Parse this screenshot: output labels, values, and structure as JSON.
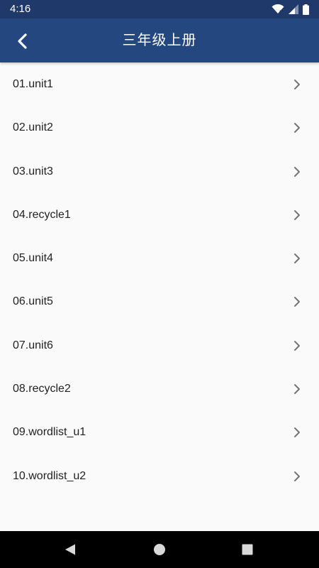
{
  "status_bar": {
    "time": "4:16",
    "icons": [
      "wifi-icon",
      "cell-signal-icon",
      "battery-icon"
    ]
  },
  "app_bar": {
    "title": "三年级上册",
    "back_icon": "back-arrow-icon",
    "background": "#24477f"
  },
  "list": {
    "items": [
      {
        "label": "01.unit1"
      },
      {
        "label": "02.unit2"
      },
      {
        "label": "03.unit3"
      },
      {
        "label": "04.recycle1"
      },
      {
        "label": "05.unit4"
      },
      {
        "label": "06.unit5"
      },
      {
        "label": "07.unit6"
      },
      {
        "label": "08.recycle2"
      },
      {
        "label": "09.wordlist_u1"
      },
      {
        "label": "10.wordlist_u2"
      }
    ],
    "item_icon": "chevron-right-icon"
  },
  "nav_bar": {
    "buttons": [
      "back-triangle-icon",
      "home-circle-icon",
      "recents-square-icon"
    ]
  }
}
